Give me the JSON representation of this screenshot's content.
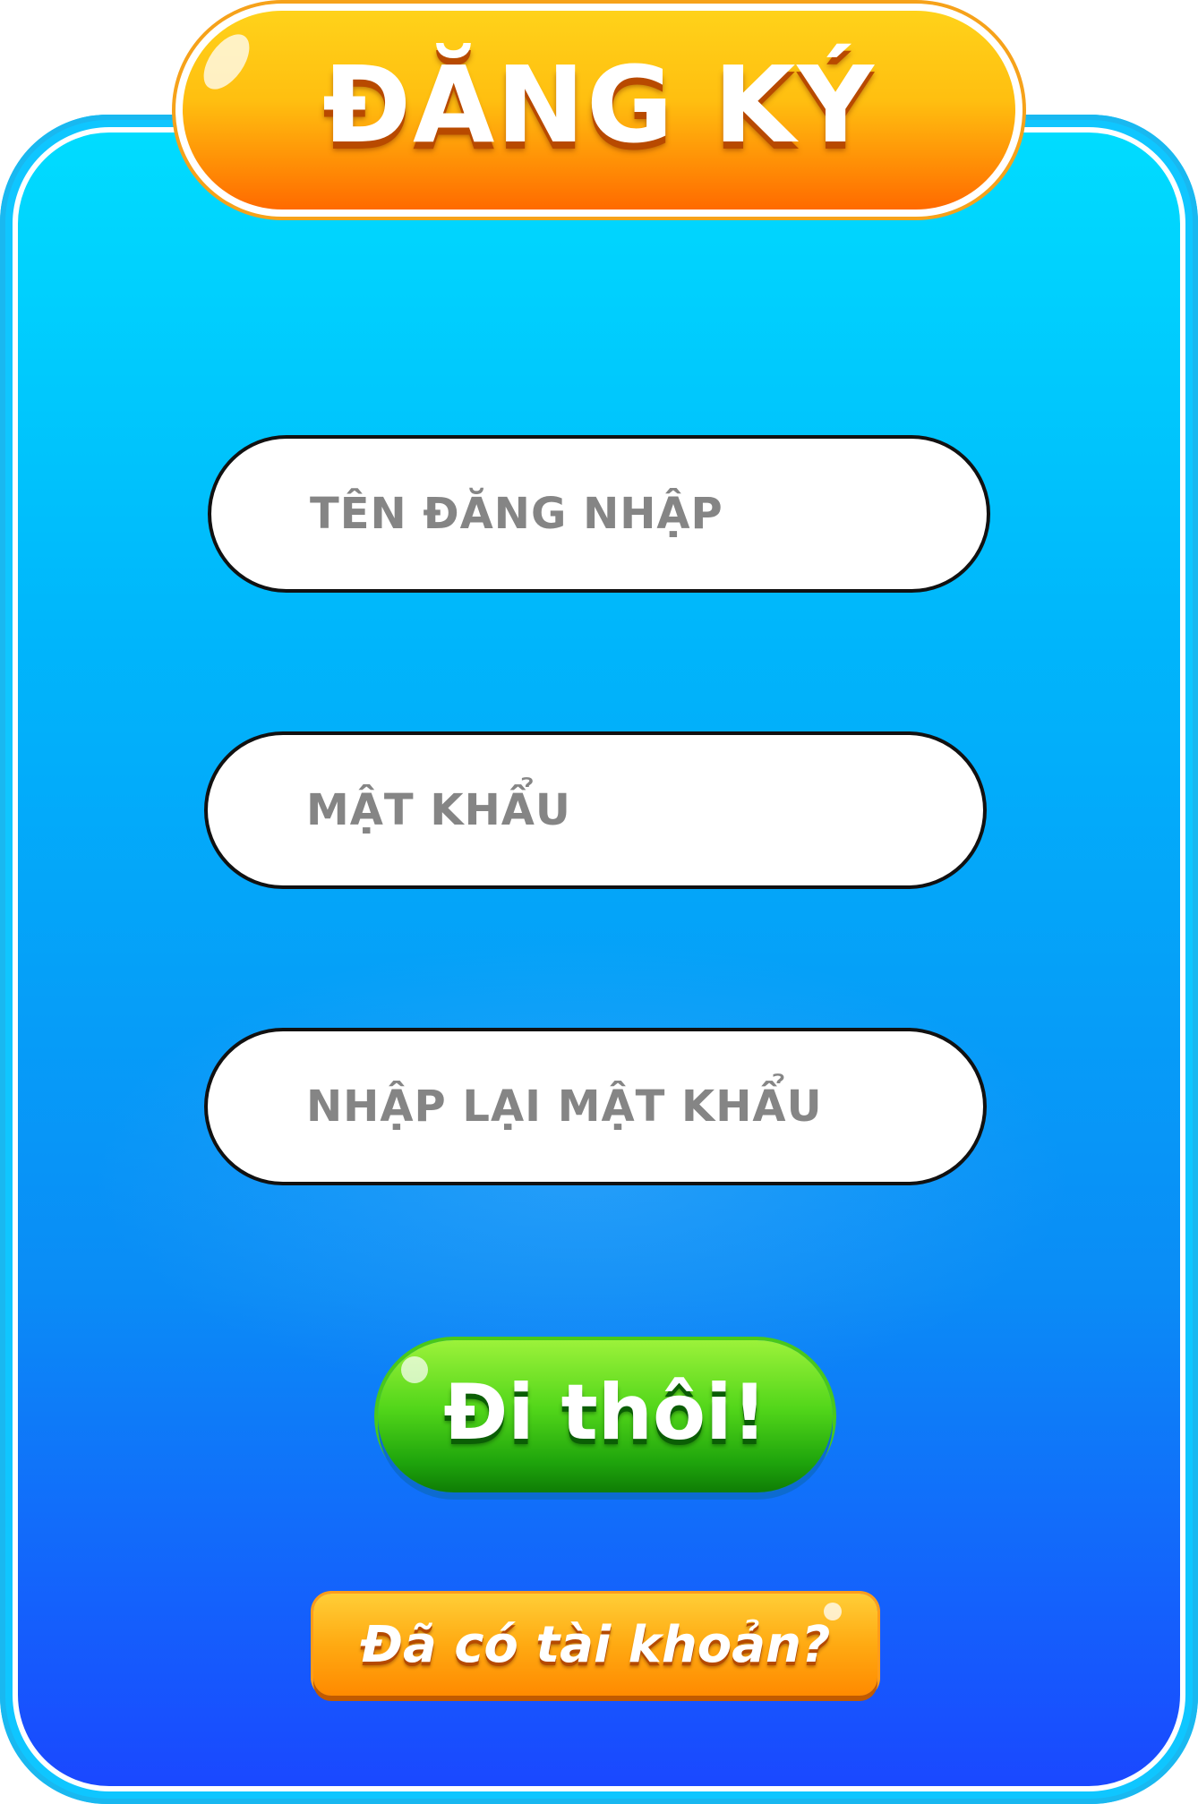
{
  "header": {
    "title": "ĐĂNG KÝ"
  },
  "form": {
    "username_placeholder": "TÊN ĐĂNG NHẬP",
    "password_placeholder": "MẬT KHẨU",
    "confirm_placeholder": "NHẬP LẠI MẬT KHẨU"
  },
  "actions": {
    "submit_label": "Đi thôi!",
    "login_link_label": "Đã có tài khoản?"
  },
  "colors": {
    "panel_top": "#00dcff",
    "panel_bottom": "#1a48ff",
    "title_orange": "#ff8a05",
    "submit_green": "#1fa50c",
    "link_orange": "#ffaa12",
    "placeholder_gray": "#858585"
  }
}
